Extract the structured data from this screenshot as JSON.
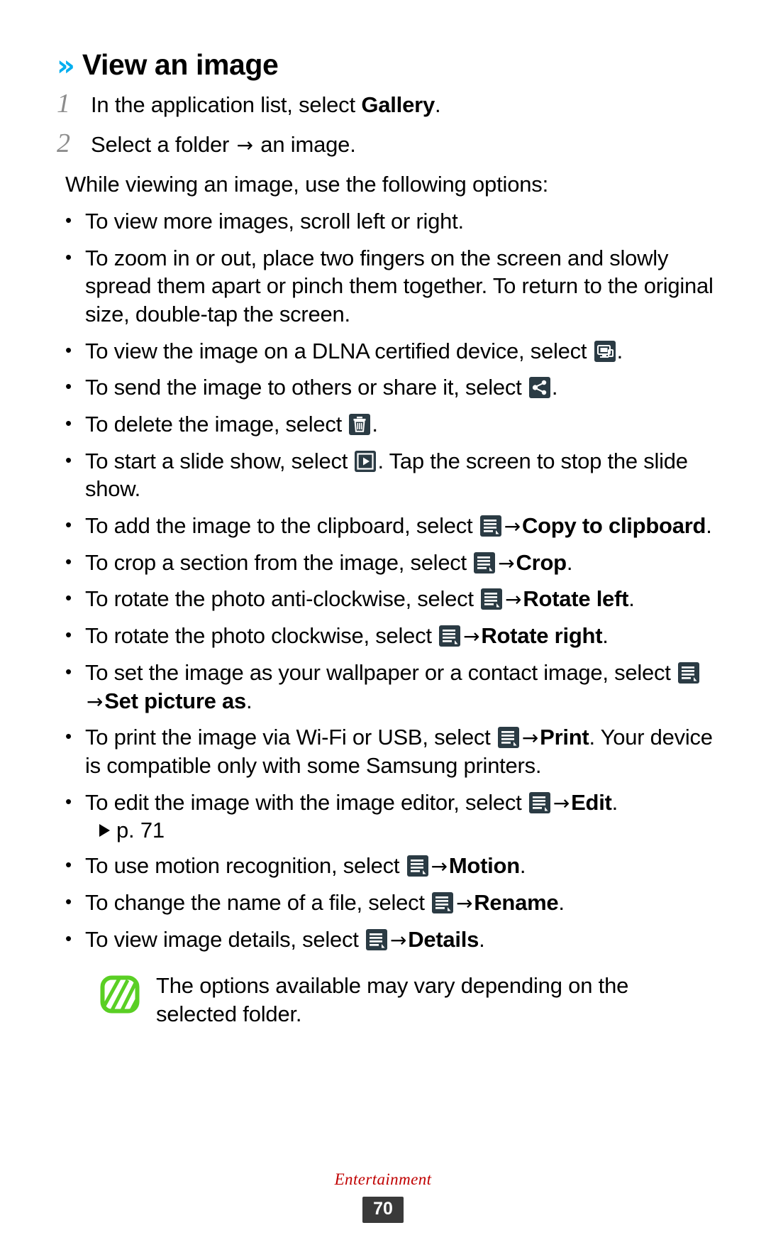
{
  "heading": {
    "chevron": "»",
    "title": "View an image",
    "accent_color": "#00AEEF"
  },
  "steps": [
    {
      "num": "1",
      "pre": "In the application list, select ",
      "bold": "Gallery",
      "post": "."
    },
    {
      "num": "2",
      "pre": "Select a folder ",
      "arrow": "→",
      "post": " an image."
    }
  ],
  "intro": "While viewing an image, use the following options:",
  "bullets": [
    {
      "name": "scroll-option",
      "text": "To view more images, scroll left or right."
    },
    {
      "name": "zoom-option",
      "text": "To zoom in or out, place two fingers on the screen and slowly spread them apart or pinch them together. To return to the original size, double-tap the screen."
    },
    {
      "name": "dlna-option",
      "pre": "To view the image on a DLNA certified device, select ",
      "icon": "monitor-icon",
      "post": "."
    },
    {
      "name": "share-option",
      "pre": "To send the image to others or share it, select ",
      "icon": "share-icon",
      "post": "."
    },
    {
      "name": "delete-option",
      "pre": "To delete the image, select ",
      "icon": "trash-icon",
      "post": "."
    },
    {
      "name": "slideshow-option",
      "pre": "To start a slide show, select ",
      "icon": "play-icon",
      "post": ". Tap the screen to stop the slide show."
    },
    {
      "name": "copy-to-clipboard-option",
      "pre": "To add the image to the clipboard, select ",
      "icon": "menu-icon",
      "arrow": "→",
      "bold": "Copy to clipboard",
      "post": "."
    },
    {
      "name": "crop-option",
      "pre": "To crop a section from the image, select ",
      "icon": "menu-icon",
      "arrow": "→",
      "bold": "Crop",
      "post": "."
    },
    {
      "name": "rotate-left-option",
      "pre": "To rotate the photo anti-clockwise, select ",
      "icon": "menu-icon",
      "arrow": "→",
      "bold": "Rotate left",
      "post": "."
    },
    {
      "name": "rotate-right-option",
      "pre": "To rotate the photo clockwise, select ",
      "icon": "menu-icon",
      "arrow": "→",
      "bold": "Rotate right",
      "post": "."
    },
    {
      "name": "set-picture-as-option",
      "pre": "To set the image as your wallpaper or a contact image, select ",
      "icon": "menu-icon",
      "arrow": "→",
      "bold": "Set picture as",
      "post": "."
    },
    {
      "name": "print-option",
      "pre": "To print the image via Wi-Fi or USB, select ",
      "icon": "menu-icon",
      "arrow": "→",
      "bold": "Print",
      "post": ". Your device is compatible only with some Samsung printers."
    },
    {
      "name": "edit-option",
      "pre": "To edit the image with the image editor, select ",
      "icon": "menu-icon",
      "arrow": "→",
      "bold": "Edit",
      "post": ".",
      "pageref": "p. 71"
    },
    {
      "name": "motion-option",
      "pre": "To use motion recognition, select ",
      "icon": "menu-icon",
      "arrow": "→",
      "bold": "Motion",
      "post": "."
    },
    {
      "name": "rename-option",
      "pre": "To change the name of a file, select ",
      "icon": "menu-icon",
      "arrow": "→",
      "bold": "Rename",
      "post": "."
    },
    {
      "name": "details-option",
      "pre": "To view image details, select ",
      "icon": "menu-icon",
      "arrow": "→",
      "bold": "Details",
      "post": "."
    }
  ],
  "note": {
    "icon": "note-icon",
    "icon_color": "#5ACF24",
    "text": "The options available may vary depending on the selected folder."
  },
  "footer": {
    "section": "Entertainment",
    "page": "70",
    "section_color": "#c00000"
  }
}
